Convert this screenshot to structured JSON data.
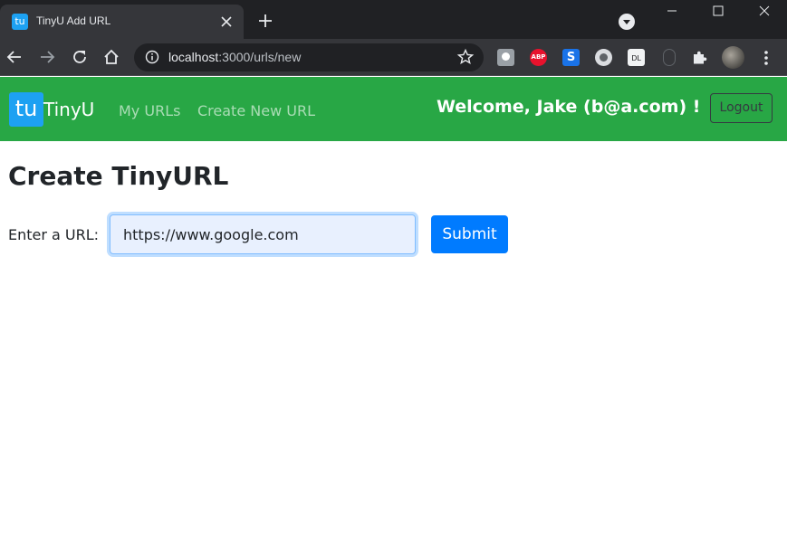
{
  "browser": {
    "tab": {
      "title": "TinyU Add URL",
      "favicon_text": "tu"
    },
    "omnibox": {
      "host": "localhost",
      "rest": ":3000/urls/new"
    },
    "extensions": {
      "abp_label": "ABP",
      "s_label": "S",
      "dl_label": "DL"
    }
  },
  "app": {
    "brand": {
      "logo_text": "tu",
      "name": "TinyU"
    },
    "nav": {
      "my_urls": "My URLs",
      "create_new": "Create New URL"
    },
    "welcome": "Welcome, Jake (b@a.com) !",
    "logout_label": "Logout"
  },
  "page": {
    "title": "Create TinyURL",
    "url_label": "Enter a URL:",
    "url_value": "https://www.google.com",
    "submit_label": "Submit"
  },
  "colors": {
    "navbar": "#28a745",
    "brand_logo": "#1da1f2",
    "submit": "#007bff"
  }
}
